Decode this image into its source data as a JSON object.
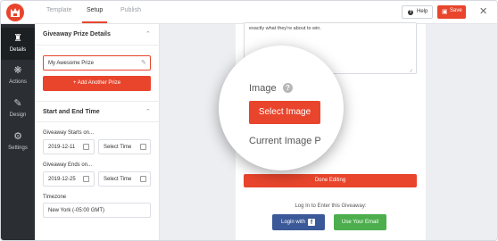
{
  "app": {
    "brand_color": "#e8452c"
  },
  "topbar": {
    "tabs": [
      {
        "label": "Template",
        "active": false
      },
      {
        "label": "Setup",
        "active": true
      },
      {
        "label": "Publish",
        "active": false
      }
    ],
    "help_label": "Help",
    "save_label": "Save"
  },
  "nav": {
    "items": [
      {
        "label": "Details",
        "icon": "trophy-icon",
        "active": true
      },
      {
        "label": "Actions",
        "icon": "actions-icon",
        "active": false
      },
      {
        "label": "Design",
        "icon": "design-icon",
        "active": false
      },
      {
        "label": "Settings",
        "icon": "gear-icon",
        "active": false
      }
    ]
  },
  "panel": {
    "prize_section": {
      "title": "Giveaway Prize Details",
      "prize_value": "My Awesome Prize",
      "add_prize_label": "+ Add Another Prize"
    },
    "time_section": {
      "title": "Start and End Time",
      "starts_label": "Giveaway Starts on...",
      "starts_date": "2019-12-11",
      "starts_time": "Select Time",
      "ends_label": "Giveaway Ends on...",
      "ends_date": "2019-12-25",
      "ends_time": "Select Time",
      "timezone_label": "Timezone",
      "timezone_value": "New York (-05:00 GMT)"
    }
  },
  "canvas": {
    "description_text": "exactly what they're about to win.",
    "done_label": "Done Editing",
    "login_text": "Log In to Enter this Giveaway:",
    "facebook_label": "Login with",
    "facebook_glyph": "f",
    "email_label": "Use Your Email"
  },
  "magnifier": {
    "image_label": "Image",
    "help_glyph": "?",
    "select_image_label": "Select Image",
    "current_image_label": "Current Image P"
  }
}
